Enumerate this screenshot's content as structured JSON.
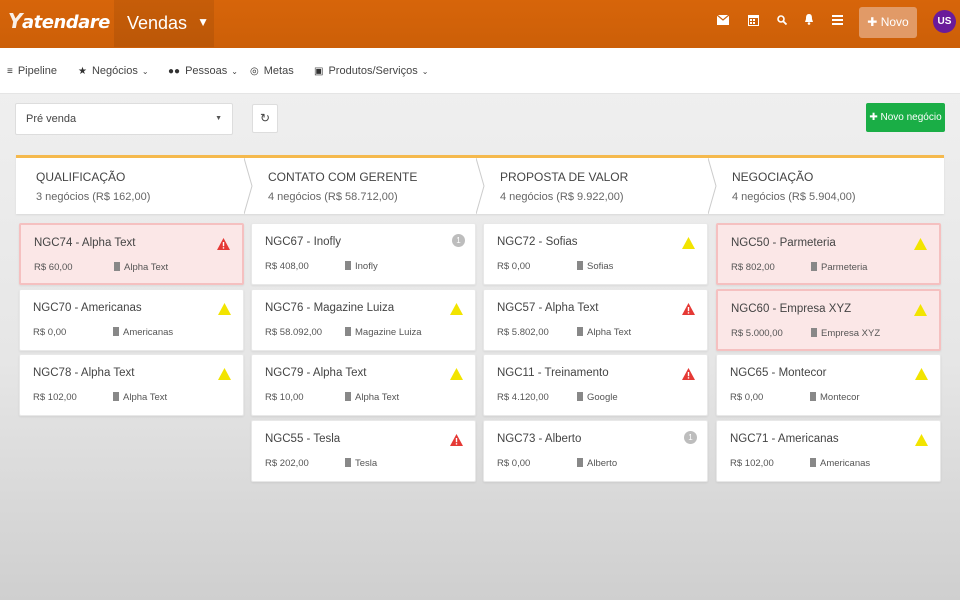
{
  "header": {
    "logo_text": "atendare",
    "module": "Vendas",
    "new_button": "Novo",
    "avatar": "US",
    "icons": [
      "mail-icon",
      "calendar-icon",
      "search-icon",
      "bell-icon",
      "list-icon"
    ]
  },
  "subnav": [
    {
      "label": "Pipeline",
      "icon": "filter-icon",
      "dropdown": false
    },
    {
      "label": "Negócios",
      "icon": "star-icon",
      "dropdown": true
    },
    {
      "label": "Pessoas",
      "icon": "people-icon",
      "dropdown": true
    },
    {
      "label": "Metas",
      "icon": "target-icon",
      "dropdown": false
    },
    {
      "label": "Produtos/Serviços",
      "icon": "cart-icon",
      "dropdown": true
    }
  ],
  "filters": {
    "pipeline_select": "Pré venda",
    "add_button": "Novo negócio"
  },
  "colors": {
    "topbar": "#d7650a",
    "accent_green": "#1aae46",
    "stage_border": "#f5b94d",
    "alert_bg": "#fbe7e7",
    "warning_red": "#e53935",
    "warning_yellow": "#f2e400",
    "avatar_bg": "#6a1b9a"
  },
  "stages": [
    {
      "name": "QUALIFICAÇÃO",
      "count": "3 negócios (R$ 162,00)",
      "cards": [
        {
          "title": "NGC74 - Alpha Text",
          "value": "R$ 60,00",
          "org": "Alpha Text",
          "status": "red",
          "alert": true
        },
        {
          "title": "NGC70 - Americanas",
          "value": "R$ 0,00",
          "org": "Americanas",
          "status": "yellow",
          "alert": false
        },
        {
          "title": "NGC78 - Alpha Text",
          "value": "R$ 102,00",
          "org": "Alpha Text",
          "status": "yellow",
          "alert": false
        }
      ]
    },
    {
      "name": "CONTATO COM GERENTE",
      "count": "4 negócios (R$ 58.712,00)",
      "cards": [
        {
          "title": "NGC67 - Inofly",
          "value": "R$ 408,00",
          "org": "Inofly",
          "status": "count",
          "badge": "1",
          "alert": false
        },
        {
          "title": "NGC76 - Magazine Luiza",
          "value": "R$ 58.092,00",
          "org": "Magazine Luiza",
          "status": "yellow",
          "alert": false
        },
        {
          "title": "NGC79 - Alpha Text",
          "value": "R$ 10,00",
          "org": "Alpha Text",
          "status": "yellow",
          "alert": false
        },
        {
          "title": "NGC55 - Tesla",
          "value": "R$ 202,00",
          "org": "Tesla",
          "status": "red",
          "alert": false
        }
      ]
    },
    {
      "name": "PROPOSTA DE VALOR",
      "count": "4 negócios (R$ 9.922,00)",
      "cards": [
        {
          "title": "NGC72 - Sofias",
          "value": "R$ 0,00",
          "org": "Sofias",
          "status": "yellow",
          "alert": false
        },
        {
          "title": "NGC57 - Alpha Text",
          "value": "R$ 5.802,00",
          "org": "Alpha Text",
          "status": "red",
          "alert": false
        },
        {
          "title": "NGC11 - Treinamento",
          "value": "R$ 4.120,00",
          "org": "Google",
          "status": "red",
          "alert": false
        },
        {
          "title": "NGC73 - Alberto",
          "value": "R$ 0,00",
          "org": "Alberto",
          "status": "count",
          "badge": "1",
          "alert": false
        }
      ]
    },
    {
      "name": "NEGOCIAÇÃO",
      "count": "4 negócios (R$ 5.904,00)",
      "cards": [
        {
          "title": "NGC50 - Parmeteria",
          "value": "R$ 802,00",
          "org": "Parmeteria",
          "status": "yellow",
          "alert": true
        },
        {
          "title": "NGC60 - Empresa XYZ",
          "value": "R$ 5.000,00",
          "org": "Empresa XYZ",
          "status": "yellow",
          "alert": true
        },
        {
          "title": "NGC65 - Montecor",
          "value": "R$ 0,00",
          "org": "Montecor",
          "status": "yellow",
          "alert": false
        },
        {
          "title": "NGC71 - Americanas",
          "value": "R$ 102,00",
          "org": "Americanas",
          "status": "yellow",
          "alert": false
        }
      ]
    }
  ]
}
